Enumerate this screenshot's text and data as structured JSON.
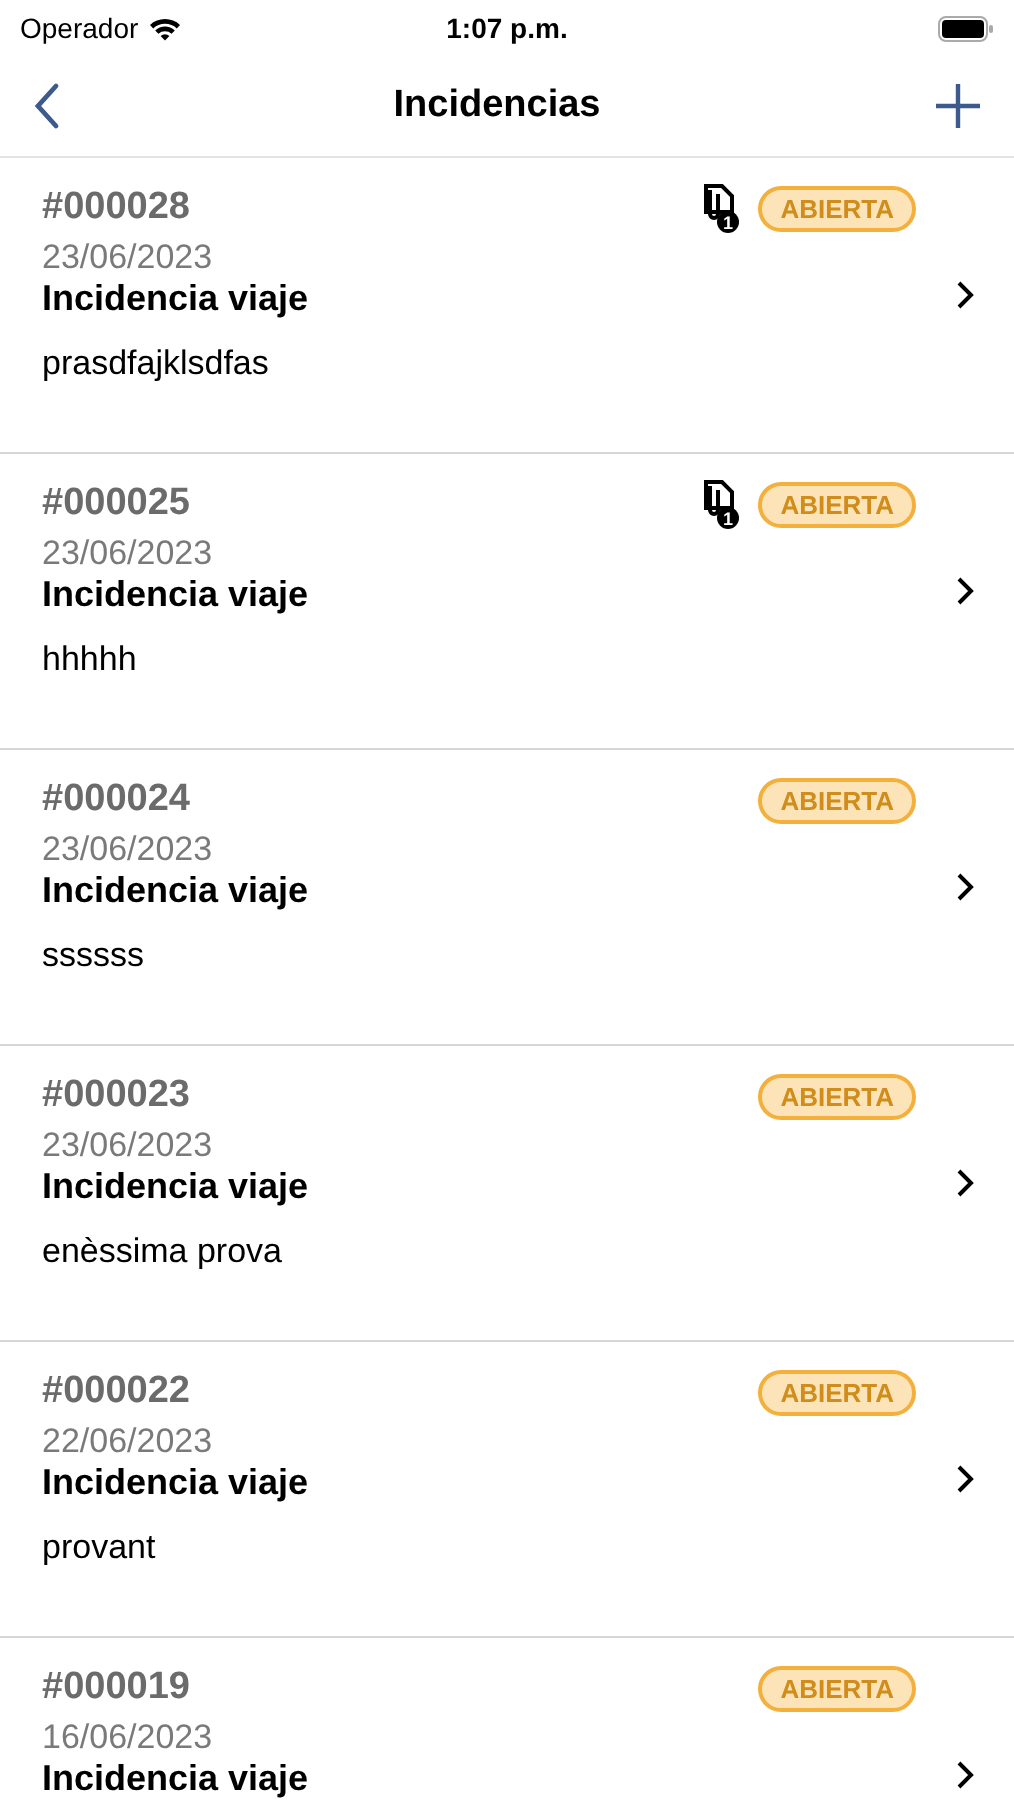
{
  "status_bar": {
    "carrier": "Operador",
    "time": "1:07 p.m."
  },
  "nav": {
    "title": "Incidencias"
  },
  "incidents": [
    {
      "number": "#000028",
      "date": "23/06/2023",
      "title": "Incidencia viaje",
      "description": "prasdfajklsdfas",
      "status": "ABIERTA",
      "attachments": "1"
    },
    {
      "number": "#000025",
      "date": "23/06/2023",
      "title": "Incidencia viaje",
      "description": "hhhhh",
      "status": "ABIERTA",
      "attachments": "1"
    },
    {
      "number": "#000024",
      "date": "23/06/2023",
      "title": "Incidencia viaje",
      "description": "ssssss",
      "status": "ABIERTA"
    },
    {
      "number": "#000023",
      "date": "23/06/2023",
      "title": "Incidencia viaje",
      "description": "enèssima prova",
      "status": "ABIERTA"
    },
    {
      "number": "#000022",
      "date": "22/06/2023",
      "title": "Incidencia viaje",
      "description": "provant",
      "status": "ABIERTA"
    },
    {
      "number": "#000019",
      "date": "16/06/2023",
      "title": "Incidencia viaje",
      "status": "ABIERTA"
    }
  ]
}
